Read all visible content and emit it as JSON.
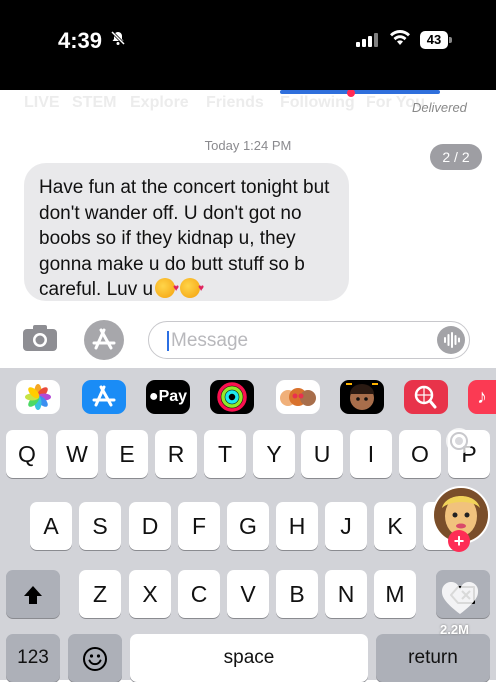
{
  "status_bar": {
    "time": "4:39",
    "battery": "43"
  },
  "background_tabs": [
    "LIVE",
    "STEM",
    "Explore",
    "Friends",
    "Following",
    "For You"
  ],
  "delivered_label": "Delivered",
  "conversation": {
    "timestamp": "Today 1:24 PM",
    "page_indicator": "2 / 2",
    "message_lines": [
      "Have fun at the concert tonight but",
      "don't wander off. U don't got no",
      "boobs so if they kidnap u, they",
      "gonna make u do butt stuff so b",
      "careful. Luv u"
    ]
  },
  "composer": {
    "placeholder": "Message"
  },
  "app_strip": {
    "apps": [
      "photos-app",
      "app-store-app",
      "apple-pay-app",
      "activity-app",
      "memoji-app",
      "memoji-stickers-app",
      "web-search-app",
      "music-app"
    ],
    "apple_pay_label": "Pay"
  },
  "keyboard": {
    "row1": [
      "Q",
      "W",
      "E",
      "R",
      "T",
      "Y",
      "U",
      "I",
      "O",
      "P"
    ],
    "row2": [
      "A",
      "S",
      "D",
      "F",
      "G",
      "H",
      "J",
      "K",
      "L"
    ],
    "row3": [
      "Z",
      "X",
      "C",
      "V",
      "B",
      "N",
      "M"
    ],
    "numbers_label": "123",
    "space_label": "space",
    "return_label": "return"
  },
  "overlay": {
    "like_count": "2.2M"
  }
}
